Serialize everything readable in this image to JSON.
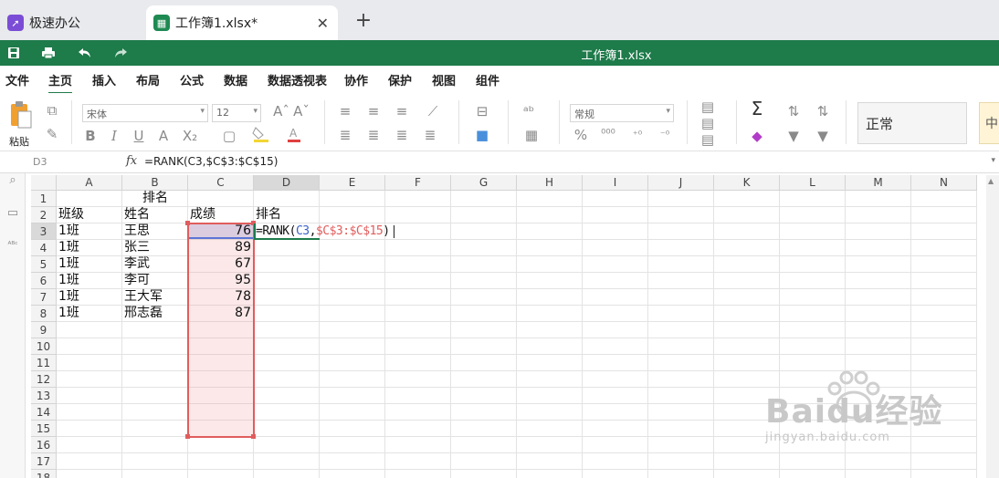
{
  "tabs": {
    "home": {
      "label": "极速办公",
      "icon": "rocket-icon"
    },
    "doc": {
      "label": "工作簿1.xlsx*",
      "icon": "sheet-icon",
      "close": "✕"
    },
    "new_tab": "+"
  },
  "titlebar": {
    "title": "工作簿1.xlsx",
    "color": "#1e7b4a"
  },
  "menu": {
    "items": [
      "文件",
      "主页",
      "插入",
      "布局",
      "公式",
      "数据",
      "数据透视表",
      "协作",
      "保护",
      "视图",
      "组件"
    ],
    "active_index": 1
  },
  "ribbon": {
    "paste_label": "粘贴",
    "font_name": "宋体",
    "font_size": "12",
    "number_format": "常规",
    "cell_style": "正常",
    "cell_style_next": "中"
  },
  "formula_bar": {
    "cell_ref": "D3",
    "fx": "fx",
    "formula": "=RANK(C3,$C$3:$C$15)"
  },
  "sheet": {
    "columns": [
      "A",
      "B",
      "C",
      "D",
      "E",
      "F",
      "G",
      "H",
      "I",
      "J",
      "K",
      "L",
      "M",
      "N"
    ],
    "rows": [
      "1",
      "2",
      "3",
      "4",
      "5",
      "6",
      "7",
      "8",
      "9",
      "10",
      "11",
      "12",
      "13",
      "14",
      "15",
      "16",
      "17",
      "18"
    ],
    "selected_column": "D",
    "selected_row": "3",
    "title_cell": "排名",
    "headers": [
      "班级",
      "姓名",
      "成绩",
      "排名"
    ],
    "records": [
      {
        "class": "1班",
        "name": "王思",
        "score": "76"
      },
      {
        "class": "1班",
        "name": "张三",
        "score": "89"
      },
      {
        "class": "1班",
        "name": "李武",
        "score": "67"
      },
      {
        "class": "1班",
        "name": "李可",
        "score": "95"
      },
      {
        "class": "1班",
        "name": "王大军",
        "score": "78"
      },
      {
        "class": "1班",
        "name": "邢志磊",
        "score": "87"
      }
    ],
    "editing": {
      "prefix": "=RANK(",
      "ref1": "C3",
      "comma": ",",
      "ref2": "$C$3:$C$15",
      "suffix": ")"
    }
  },
  "watermark": {
    "brand": "Baidu经验",
    "url": "jingyan.baidu.com"
  }
}
